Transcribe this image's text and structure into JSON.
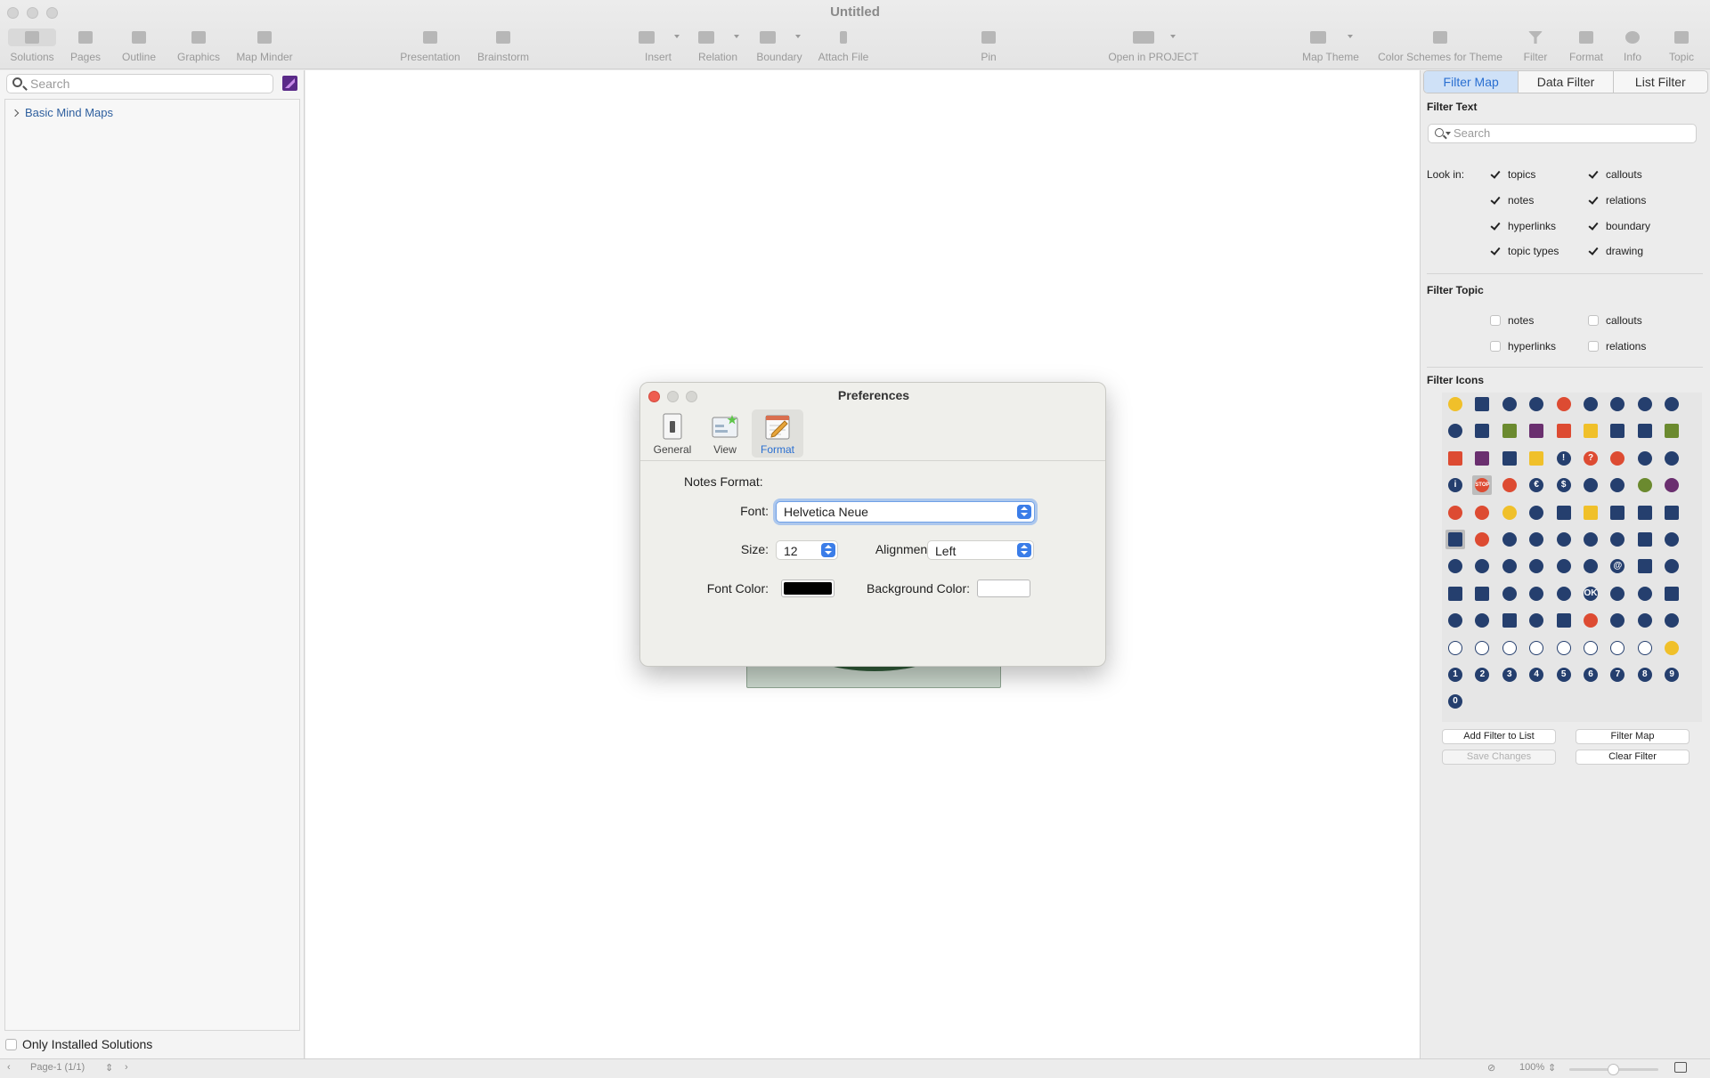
{
  "window": {
    "title": "Untitled"
  },
  "toolbar": {
    "items": [
      {
        "label": "Solutions"
      },
      {
        "label": "Pages"
      },
      {
        "label": "Outline"
      },
      {
        "label": "Graphics"
      },
      {
        "label": "Map Minder"
      },
      {
        "label": "Presentation"
      },
      {
        "label": "Brainstorm"
      },
      {
        "label": "Insert"
      },
      {
        "label": "Relation"
      },
      {
        "label": "Boundary"
      },
      {
        "label": "Attach File"
      },
      {
        "label": "Pin"
      },
      {
        "label": "Open in PROJECT"
      },
      {
        "label": "Map Theme"
      },
      {
        "label": "Color Schemes for Theme"
      },
      {
        "label": "Filter"
      },
      {
        "label": "Format"
      },
      {
        "label": "Info"
      },
      {
        "label": "Topic"
      }
    ]
  },
  "sidebar": {
    "search_placeholder": "Search",
    "tree_item": "Basic Mind Maps",
    "only_installed": "Only Installed Solutions"
  },
  "right_panel": {
    "tabs": [
      "Filter Map",
      "Data Filter",
      "List Filter"
    ],
    "filter_text_heading": "Filter Text",
    "search_placeholder": "Search",
    "look_in_label": "Look in:",
    "look_in": [
      {
        "label": "topics",
        "checked": true
      },
      {
        "label": "callouts",
        "checked": true
      },
      {
        "label": "notes",
        "checked": true
      },
      {
        "label": "relations",
        "checked": true
      },
      {
        "label": "hyperlinks",
        "checked": true
      },
      {
        "label": "boundary",
        "checked": true
      },
      {
        "label": "topic types",
        "checked": true
      },
      {
        "label": "drawing",
        "checked": true
      }
    ],
    "filter_topic_heading": "Filter Topic",
    "filter_topic": [
      {
        "label": "notes",
        "checked": false
      },
      {
        "label": "callouts",
        "checked": false
      },
      {
        "label": "hyperlinks",
        "checked": false
      },
      {
        "label": "relations",
        "checked": false
      }
    ],
    "filter_icons_heading": "Filter Icons",
    "icon_rows": [
      [
        "bulb-icon",
        "clock-icon",
        "magnifier-person-icon",
        "check-icon",
        "cross-icon",
        "smile-icon",
        "sad-icon",
        "frown-icon",
        "angry-icon"
      ],
      [
        "upset-icon",
        "arrow-up-icon",
        "arrow-right-icon",
        "arrow-down-icon",
        "arrow-left-icon",
        "arrow-left-right-icon",
        "flag-black-icon",
        "flag-blue-icon",
        "flag-green-icon"
      ],
      [
        "flag-red-icon",
        "flag-purple-icon",
        "flag-pink-icon",
        "flag-yellow-icon",
        "exclamation-icon",
        "question-icon",
        "hand-icon",
        "bomb-icon",
        "key-icon"
      ],
      [
        "info-icon",
        "stop-icon",
        "no-entry-icon",
        "euro-icon",
        "dollar-icon",
        "pin-black-icon",
        "pin-blue-icon",
        "pin-green-icon",
        "pin-purple-icon"
      ],
      [
        "pin-orange-icon",
        "pin-red-icon",
        "pin-yellow-icon",
        "refresh-icon",
        "lock-icon",
        "unlock-icon",
        "save-icon",
        "folder-icon",
        "document-icon"
      ],
      [
        "notebook-icon",
        "handshake-icon",
        "search-icon",
        "person-icon",
        "glasses-icon",
        "eye-icon",
        "group-icon",
        "hourglass-icon",
        "bell-icon"
      ],
      [
        "megaphone-icon",
        "globe-person-icon",
        "coffee-icon",
        "home-icon",
        "envelope-icon",
        "globe-icon",
        "at-icon",
        "mailbox-icon",
        "link-icon"
      ],
      [
        "fax-icon",
        "mobile-icon",
        "phone-icon",
        "thumbs-up-icon",
        "thumbs-down-icon",
        "ok-icon",
        "user-circle-icon",
        "people-icon",
        "id-card-icon"
      ],
      [
        "lightning-icon",
        "camera-icon",
        "calendar-icon",
        "gavel-icon",
        "building-icon",
        "heart-icon",
        "footprints-icon",
        "rocket-icon",
        "scales-icon"
      ],
      [
        "progress-0-icon",
        "progress-1-icon",
        "progress-2-icon",
        "progress-3-icon",
        "progress-4-icon",
        "progress-5-icon",
        "progress-6-icon",
        "progress-7-icon",
        "progress-8-icon"
      ],
      [
        "number-1-icon",
        "number-2-icon",
        "number-3-icon",
        "number-4-icon",
        "number-5-icon",
        "number-6-icon",
        "number-7-icon",
        "number-8-icon",
        "number-9-icon"
      ],
      [
        "number-0-icon"
      ]
    ],
    "icon_glyphs": {
      "number-1-icon": "1",
      "number-2-icon": "2",
      "number-3-icon": "3",
      "number-4-icon": "4",
      "number-5-icon": "5",
      "number-6-icon": "6",
      "number-7-icon": "7",
      "number-8-icon": "8",
      "number-9-icon": "9",
      "number-0-icon": "0",
      "ok-icon": "OK",
      "info-icon": "i",
      "exclamation-icon": "!",
      "question-icon": "?",
      "euro-icon": "€",
      "dollar-icon": "$",
      "at-icon": "@",
      "stop-icon": "STOP"
    },
    "buttons": {
      "add_filter": "Add Filter to List",
      "filter_map": "Filter Map",
      "save_changes": "Save Changes",
      "clear_filter": "Clear Filter"
    }
  },
  "status_bar": {
    "page": "Page-1 (1/1)",
    "zoom": "100%",
    "zoom_level": 0.5
  },
  "preferences": {
    "title": "Preferences",
    "tabs": [
      {
        "label": "General",
        "icon": "switch-icon"
      },
      {
        "label": "View",
        "icon": "view-window-icon"
      },
      {
        "label": "Format",
        "icon": "pencil-notepad-icon"
      }
    ],
    "active_tab": "Format",
    "notes_format_label": "Notes Format:",
    "font_label": "Font:",
    "font_value": "Helvetica Neue",
    "size_label": "Size:",
    "size_value": "12",
    "alignment_label": "Alignment:",
    "alignment_value": "Left",
    "font_color_label": "Font Color:",
    "font_color": "#000000",
    "background_color_label": "Background Color:",
    "background_color": "#ffffff"
  },
  "colors": {
    "accent": "#2a6fd1",
    "tab_active_bg": "#cfe1f7",
    "close_red": "#ee5d50",
    "topic_dark_green": "#2f5a38"
  }
}
